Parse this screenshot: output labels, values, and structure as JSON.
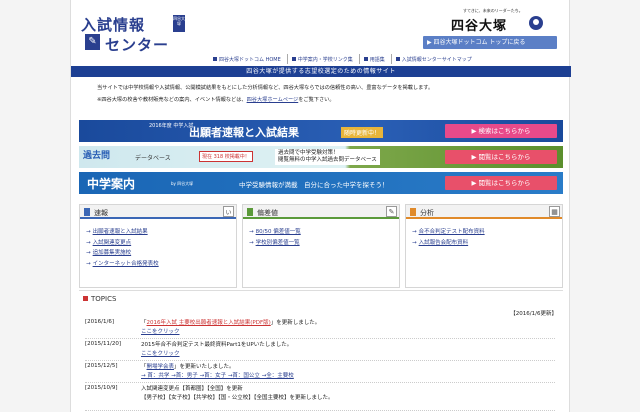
{
  "header": {
    "logo_line1": "入試情報",
    "logo_square": "四谷大塚",
    "logo_line2": "センター",
    "brand_tag": "すてきに、未来のリーダーたち。",
    "brand_name": "四谷大塚",
    "back_button": "▶ 四谷大塚ドットコム トップに戻る"
  },
  "topnav": [
    "四谷大塚ドットコム HOME",
    "中学案内・学校リンク集",
    "用語集",
    "入試情報センターサイトマップ"
  ],
  "blue_bar": "四谷大塚が提供する志望校選定のための情報サイト",
  "intro": {
    "line1": "当サイトでは中学校情報や入試情報、公開模試結果をもとにした分析情報など、四谷大塚ならではの信頼性の高い、豊富なデータを掲載します。",
    "line2_prefix": "※四谷大塚の校舎や教材販売などの案内、イベント情報などは、",
    "line2_link": "四谷大塚ホームページ",
    "line2_suffix": "をご覧下さい。"
  },
  "banners": {
    "b1_tag": "2016年度 中学入試",
    "b1_title": "出願者速報と入試結果",
    "b1_sub": "随時更新中！",
    "b1_button": "▶ 検索はこちらから",
    "b2_logo": "過去問",
    "b2_sub": "データベース",
    "b2_badge": "現在 318 校掲載中！",
    "b2_text1": "過去問で中学受験対策！",
    "b2_text2": "閲覧無料の中学入試過去問データベース",
    "b2_button": "▶ 閲覧はこちらから",
    "b3_title": "中学案内",
    "b3_by": "by 四谷大塚",
    "b3_text": "中学受験情報が満載　自分に合った中学を探そう！",
    "b3_button": "▶ 閲覧はこちらから"
  },
  "boxes": [
    {
      "title": "速報",
      "icon": "ぃ",
      "items": [
        "出願者速報と入試結果",
        "入試関連変更点",
        "追加募集実施校",
        "インターネット合格発表校"
      ]
    },
    {
      "title": "偏差値",
      "icon": "✎",
      "items": [
        "80/50 偏差値一覧",
        "学校別偏差値一覧"
      ]
    },
    {
      "title": "分析",
      "icon": "▦",
      "items": [
        "合不合判定テスト配布資料",
        "入試報告会配布資料"
      ]
    }
  ],
  "topics": {
    "title": "TOPICS",
    "updated": "【2016/1/6更新】",
    "rows": [
      {
        "date": "[2016/1/6]",
        "line1_pre": "「",
        "line1_link": "2016年入試 主要校出願者速報と入試結果(PDF版)",
        "line1_post": "」を更新しました。",
        "line2": "ここをクリック"
      },
      {
        "date": "[2015/11/20]",
        "line1_pre": "2015年合不合判定テスト最終資料Part1をUPいたしました。",
        "line1_link": "",
        "line1_post": "",
        "line2": "ここをクリック"
      },
      {
        "date": "[2015/12/5]",
        "line1_pre": "「",
        "line1_link": "開場学会表",
        "line1_post": "」を更新いたしました。",
        "line2": "→ 首：共学 →首：男子 →首：女子 →首：国公立 →全：主要校"
      },
      {
        "date": "[2015/10/9]",
        "line1_pre": "入試関連変更点【首都圏】【全国】を更新",
        "line1_link": "",
        "line1_post": "",
        "line2": "【男子校】【女子校】【共学校】【国・公立校】【全国主要校】を更新しました。"
      }
    ]
  }
}
